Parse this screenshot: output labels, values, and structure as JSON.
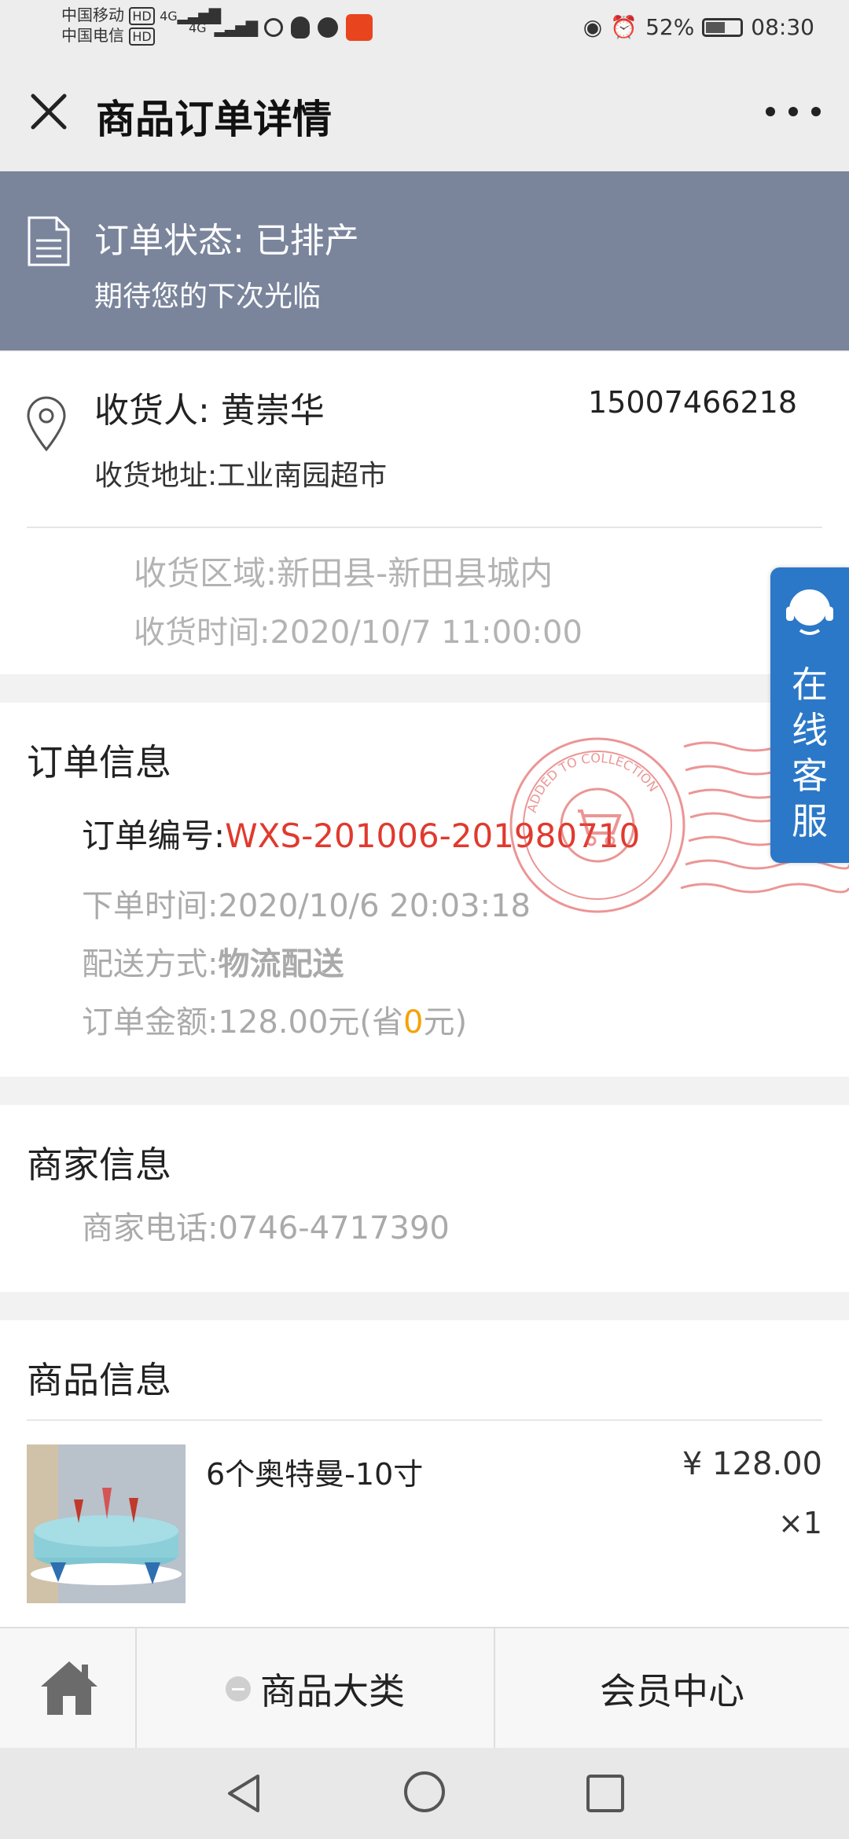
{
  "status_bar": {
    "carrier1": "中国移动",
    "carrier2": "中国电信",
    "net1": "4G",
    "net2": "4G",
    "battery_percent": "52%",
    "battery_level": 0.52,
    "time": "08:30"
  },
  "header": {
    "title": "商品订单详情"
  },
  "order_status": {
    "status": "订单状态: 已排产",
    "subtitle": "期待您的下次光临"
  },
  "address": {
    "receiver": "收货人: 黄崇华",
    "phone": "15007466218",
    "address": "收货地址:工业南园超市",
    "region": "收货区域:新田县-新田县城内",
    "time": "收货时间:2020/10/7  11:00:00"
  },
  "order_info": {
    "title": "订单信息",
    "number_label": "订单编号:",
    "number": "WXS-201006-201980710",
    "order_time": "下单时间:2020/10/6  20:03:18",
    "delivery_label": "配送方式:",
    "delivery_value": "物流配送",
    "amount_prefix": "订单金额:128.00元(省",
    "amount_saved": "0",
    "amount_suffix": "元)"
  },
  "merchant": {
    "title": "商家信息",
    "phone": "商家电话:0746-4717390"
  },
  "goods": {
    "title": "商品信息",
    "items": [
      {
        "name": "6个奥特曼-10寸",
        "price": "¥ 128.00",
        "qty": "×1"
      }
    ]
  },
  "service": {
    "label_chars": [
      "在",
      "线",
      "客",
      "服"
    ]
  },
  "stamp": {
    "text": "ADDED TO COLLECTION"
  },
  "tabbar": {
    "category": "商品大类",
    "member": "会员中心"
  },
  "colors": {
    "banner": "#7a859c",
    "order_number": "#e03a2e",
    "saved": "#f5a200",
    "service": "#2b78c8",
    "stamp": "#e05050"
  }
}
